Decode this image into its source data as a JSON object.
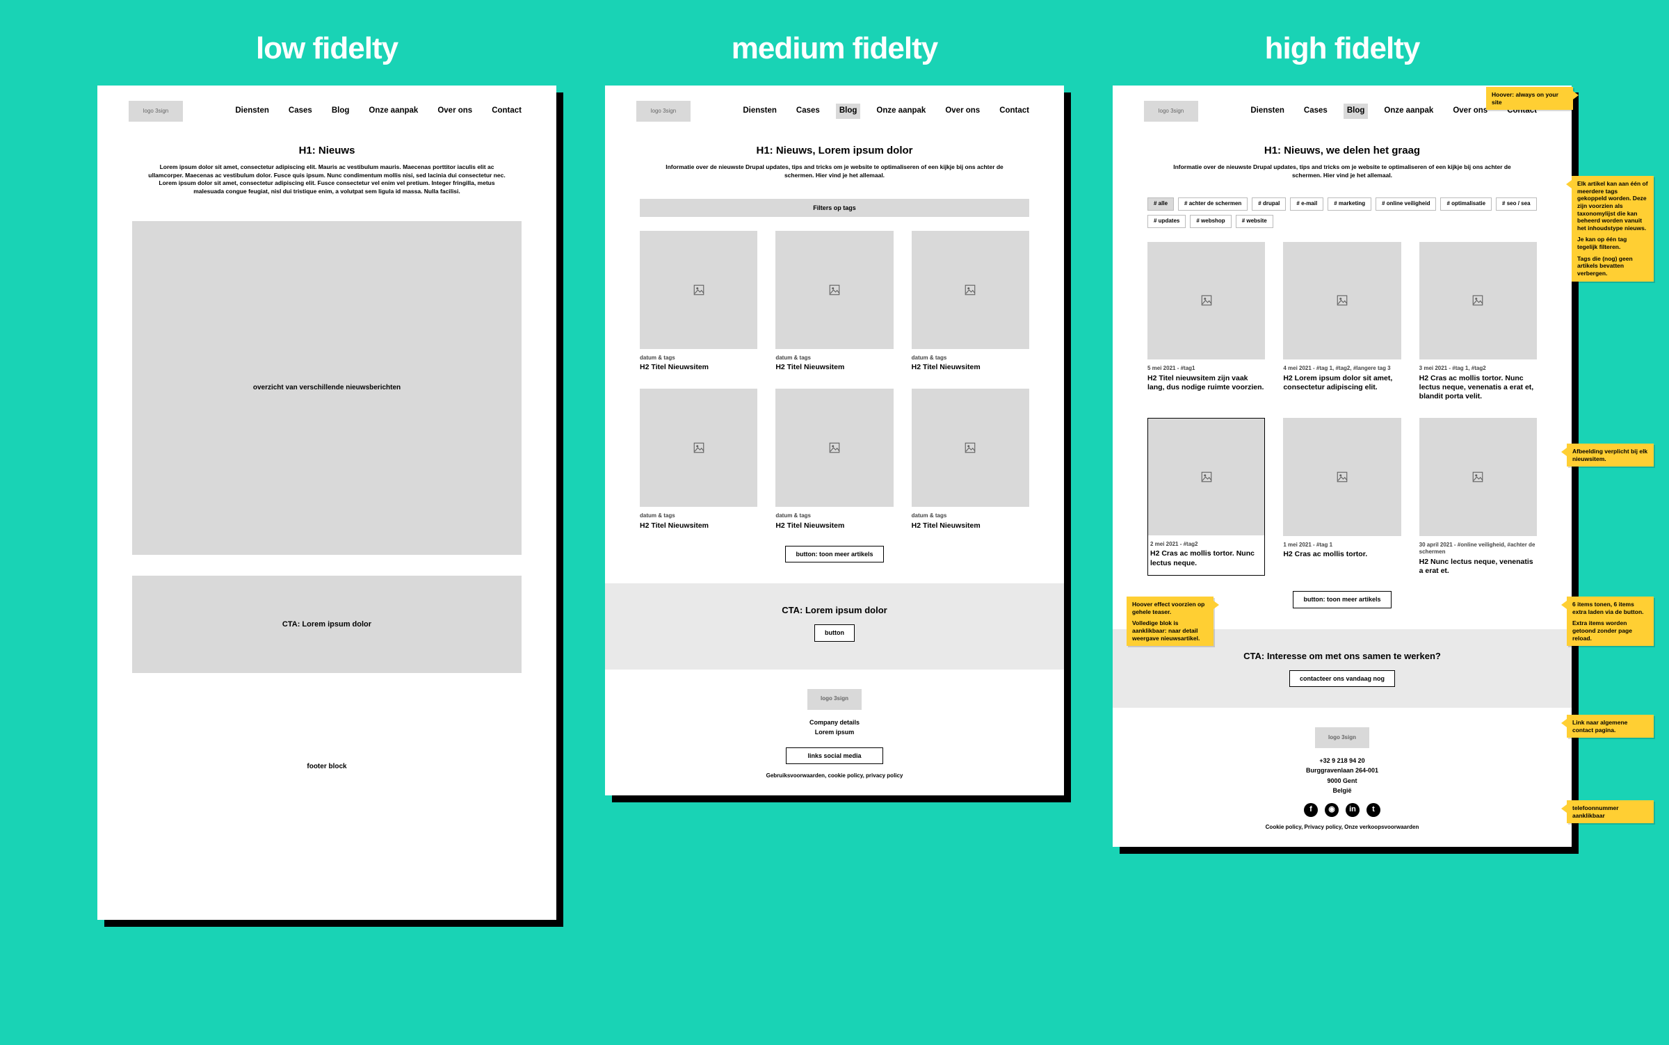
{
  "titles": {
    "low": "low fidelty",
    "medium": "medium fidelty",
    "high": "high fidelty"
  },
  "logo_text": "logo 3sign",
  "nav": [
    "Diensten",
    "Cases",
    "Blog",
    "Onze aanpak",
    "Over ons",
    "Contact"
  ],
  "low": {
    "h1": "H1: Nieuws",
    "intro": "Lorem ipsum dolor sit amet, consectetur adipiscing elit. Mauris ac vestibulum mauris. Maecenas porttitor iaculis elit ac ullamcorper. Maecenas ac vestibulum dolor. Fusce quis ipsum. Nunc condimentum mollis nisi, sed lacinia dui consectetur nec. Lorem ipsum dolor sit amet, consectetur adipiscing elit. Fusce consectetur vel enim vel pretium. Integer fringilla, metus malesuada congue feugiat, nisl dui tristique enim, a volutpat sem ligula id massa. Nulla facilisi.",
    "overview_text": "overzicht van verschillende nieuwsberichten",
    "cta": "CTA: Lorem ipsum dolor",
    "footer": "footer block"
  },
  "medium": {
    "h1": "H1: Nieuws, Lorem ipsum dolor",
    "intro": "Informatie over de nieuwste Drupal updates, tips and tricks om je website te optimaliseren of een kijkje bij ons achter de schermen. Hier vind je het allemaal.",
    "filter_label": "Filters op tags",
    "card_meta": "datum & tags",
    "card_title": "H2 Titel Nieuwsitem",
    "more_btn": "button: toon meer artikels",
    "cta_h": "CTA: Lorem ipsum dolor",
    "cta_btn": "button",
    "company_h": "Company details",
    "company_b": "Lorem ipsum",
    "social_bar": "links social media",
    "legal": "Gebruiksvoorwaarden, cookie policy, privacy policy"
  },
  "high": {
    "h1": "H1: Nieuws, we delen het graag",
    "intro": "Informatie over de nieuwste Drupal updates, tips and tricks om je website te optimaliseren of een kijkje bij ons achter de schermen. Hier vind je het allemaal.",
    "tags": [
      "# alle",
      "# achter de schermen",
      "# drupal",
      "# e-mail",
      "# marketing",
      "# online veiligheid",
      "# optimalisatie",
      "# seo / sea",
      "# updates",
      "# webshop",
      "# website"
    ],
    "cards": [
      {
        "meta": "5 mei 2021 - #tag1",
        "title": "H2 Titel nieuwsitem zijn vaak lang, dus nodige ruimte voorzien."
      },
      {
        "meta": "4 mei 2021 - #tag 1, #tag2, #langere tag 3",
        "title": "H2 Lorem ipsum dolor sit amet, consectetur adipiscing elit."
      },
      {
        "meta": "3 mei 2021 - #tag 1, #tag2",
        "title": "H2 Cras ac mollis tortor. Nunc lectus neque, venenatis a erat et, blandit porta velit."
      },
      {
        "meta": "2 mei 2021 - #tag2",
        "title": "H2 Cras ac mollis tortor. Nunc lectus neque.",
        "hover": true
      },
      {
        "meta": "1 mei 2021 - #tag 1",
        "title": "H2 Cras ac mollis tortor."
      },
      {
        "meta": "30 april 2021 - #online veiligheid, #achter de schermen",
        "title": "H2 Nunc lectus neque, venenatis a erat et."
      }
    ],
    "more_btn": "button: toon meer artikels",
    "cta_h": "CTA: Interesse om met ons samen te werken?",
    "cta_btn": "contacteer ons vandaag nog",
    "phone": "+32 9 218 94 20",
    "addr1": "Burggravenlaan 264-001",
    "addr2": "9000 Gent",
    "addr3": "België",
    "legal": "Cookie policy, Privacy policy, Onze verkoopsvoorwaarden"
  },
  "notes": {
    "hover_nav": "Hoover: always on your site",
    "tags_note": "Elk artikel kan aan één of meerdere tags gekoppeld worden. Deze zijn voorzien als taxonomylijst die kan beheerd worden vanuit het inhoudstype nieuws.",
    "tags_note2": "Je kan op één tag tegelijk filteren.",
    "tags_note3": "Tags die (nog) geen artikels bevatten verbergen.",
    "img_req": "Afbeelding verplicht bij elk nieuwsitem.",
    "hover_card": "Hoover effect voorzien op gehele teaser.",
    "hover_card2": "Volledige blok is aanklikbaar: naar detail weergave nieuwsartikel.",
    "load_more": "6 items tonen, 6 items extra laden via de button.",
    "load_more2": "Extra items worden getoond zonder page reload.",
    "cta_link": "Link naar algemene contact pagina.",
    "phone_click": "telefoonnummer aanklikbaar"
  }
}
